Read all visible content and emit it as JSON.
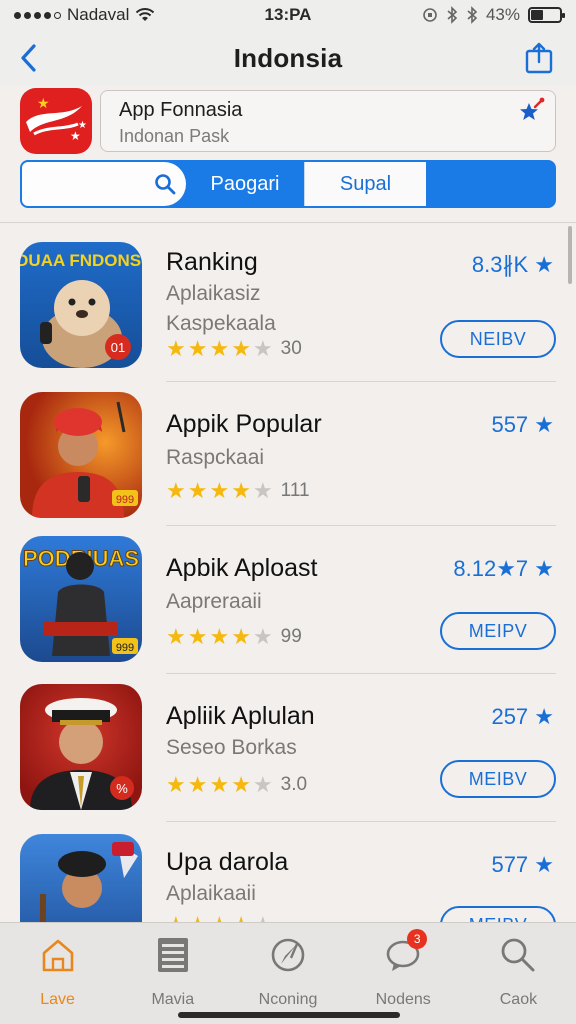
{
  "status_bar": {
    "carrier": "Nadaval",
    "time": "13:PA",
    "battery": "43%",
    "battery_level": 0.43
  },
  "nav": {
    "title": "Indonsia",
    "back_icon": "chevron-left-icon",
    "share_icon": "share-icon"
  },
  "header_app": {
    "name": "App Fonnasia",
    "subtitle": "Indonan Pask",
    "favorite_icon": "star-pin-icon"
  },
  "segment": {
    "search_icon": "search-icon",
    "tabs": [
      {
        "label": "Paogari",
        "active": true
      },
      {
        "label": "Supal",
        "active": false
      }
    ]
  },
  "apps": [
    {
      "title": "Ranking",
      "sub1": "Aplaikasiz",
      "sub2": "Kaspekaala",
      "rating": 4,
      "reviews": "30",
      "score": "8.3∦K ★",
      "button": "NEIBV",
      "icon_text": "RIDUAA FNDONSIIN",
      "icon_badge": "01",
      "icon_bg": "#1e66c4"
    },
    {
      "title": "Appik Popular",
      "sub1": "Raspckaai",
      "sub2": "",
      "rating": 4,
      "reviews": "111",
      "score": "557 ★",
      "button": "",
      "icon_text": "",
      "icon_badge": "999",
      "icon_bg": "#c23a14"
    },
    {
      "title": "Apbik Aploast",
      "sub1": "Aapreraaii",
      "sub2": "",
      "rating": 4,
      "reviews": "99",
      "score": "8.12★7 ★",
      "button": "MEIPV",
      "icon_text": "PODRIUAS",
      "icon_badge": "999",
      "icon_bg": "#1f5aa8"
    },
    {
      "title": "Apliik Aplulan",
      "sub1": "Seseo Borkas",
      "sub2": "",
      "rating": 4,
      "reviews": "3.0",
      "score": "257 ★",
      "button": "MEIBV",
      "icon_text": "",
      "icon_badge": "%",
      "icon_bg": "#b8221c"
    },
    {
      "title": "Upa darola",
      "sub1": "Aplaikaaii",
      "sub2": "",
      "rating": 4,
      "reviews": "",
      "score": "577 ★",
      "button": "MEIBV",
      "icon_text": "",
      "icon_badge": "",
      "icon_bg": "#2d5fb0"
    }
  ],
  "tab_bar": {
    "tabs": [
      {
        "label": "Lave",
        "icon": "home-icon",
        "active": true
      },
      {
        "label": "Mavia",
        "icon": "news-icon",
        "active": false
      },
      {
        "label": "Nconing",
        "icon": "compass-icon",
        "active": false
      },
      {
        "label": "Nodens",
        "icon": "chat-icon",
        "active": false,
        "badge": "3"
      },
      {
        "label": "Caok",
        "icon": "search-icon",
        "active": false
      }
    ]
  },
  "colors": {
    "accent": "#1a7ae6",
    "active_tab": "#e8871e",
    "star": "#f5b80f",
    "badge": "#e6321e"
  }
}
